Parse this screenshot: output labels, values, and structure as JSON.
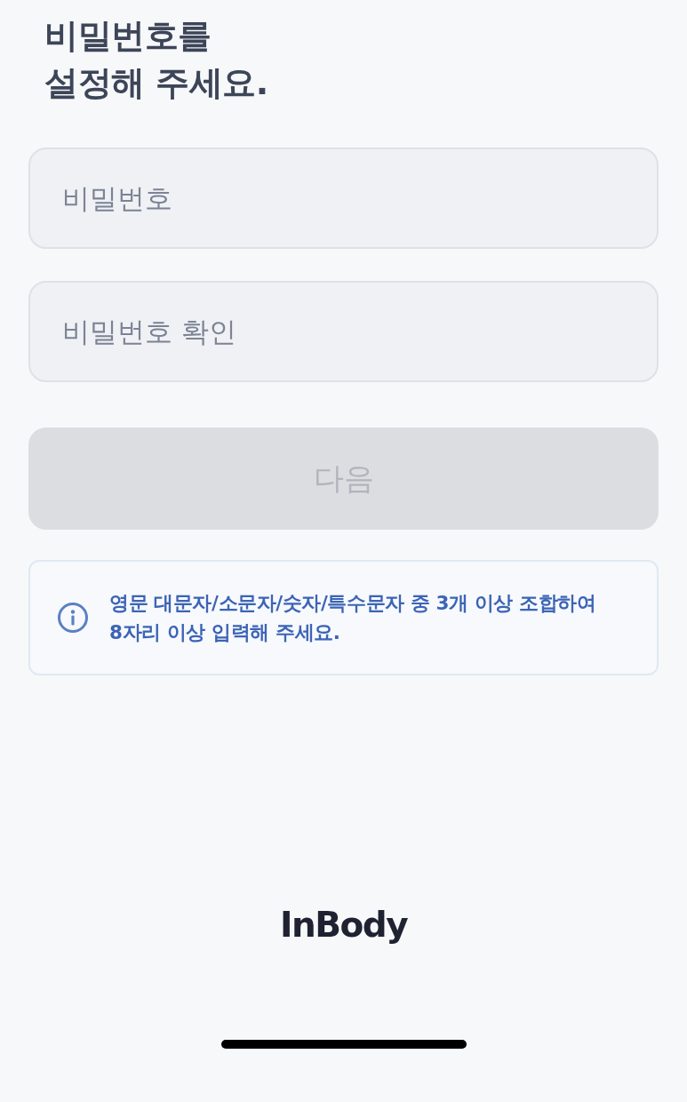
{
  "title": "비밀번호를\n설정해 주세요.",
  "fields": [
    {
      "placeholder": "비밀번호"
    },
    {
      "placeholder": "비밀번호 확인"
    }
  ],
  "next_button": {
    "label": "다음",
    "disabled": true
  },
  "notice": {
    "text": "영문 대문자/소문자/숫자/특수문자 중 3개 이상 조합하여\n8자리 이상 입력해 주세요."
  },
  "logo": "InBody"
}
